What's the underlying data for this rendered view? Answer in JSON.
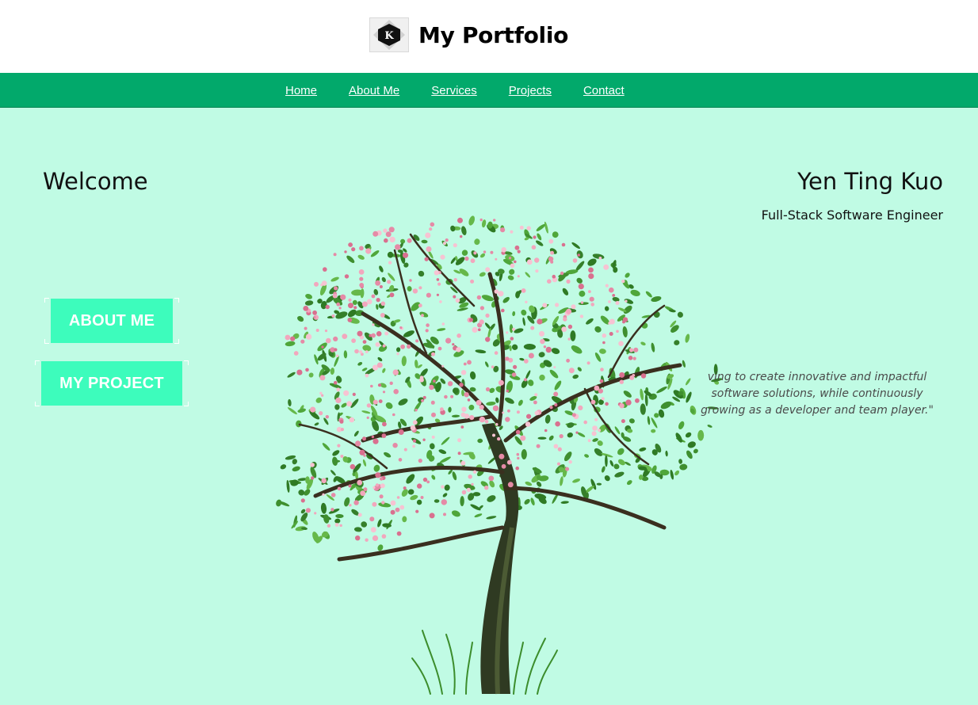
{
  "header": {
    "logo_letter": "K",
    "title": "My Portfolio"
  },
  "nav": {
    "items": [
      "Home",
      "About Me",
      "Services",
      "Projects",
      "Contact"
    ]
  },
  "hero": {
    "welcome": "Welcome",
    "name": "Yen Ting Kuo",
    "role": "Full-Stack Software Engineer",
    "quote_lines": [
      "ving to create innovative and impactful",
      "software solutions, while continuously",
      "growing as a developer and team player.\""
    ],
    "buttons": {
      "about": "ABOUT ME",
      "project": "MY PROJECT"
    }
  },
  "colors": {
    "page_bg": "#c0fbe4",
    "nav_bg": "#02a96b",
    "button_bg": "#3dfcbc",
    "blossom": "#e58aa6",
    "leaf": "#3f8f2f"
  },
  "icons": {
    "logo": "k-logo-icon",
    "tree": "cherry-blossom-tree-image"
  }
}
